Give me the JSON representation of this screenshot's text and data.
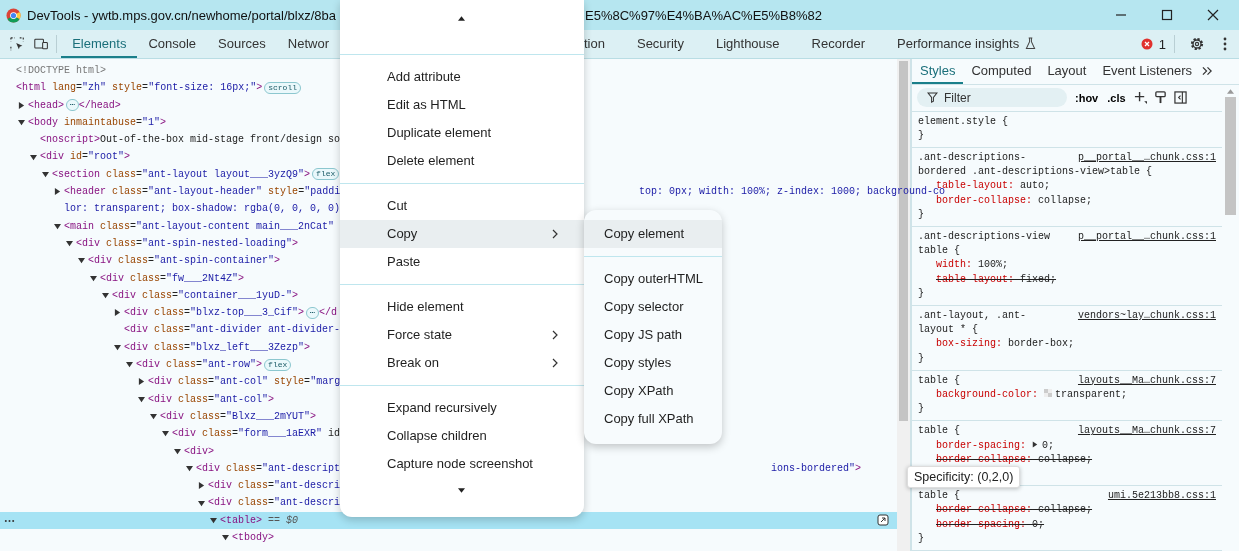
{
  "window": {
    "title": "DevTools - ywtb.mps.gov.cn/newhome/portal/blxz/8ba",
    "title_after_menu": "E5%8C%97%E4%BA%AC%E5%B8%82"
  },
  "tabs": [
    {
      "label": "Elements",
      "selected": true
    },
    {
      "label": "Console",
      "selected": false
    },
    {
      "label": "Sources",
      "selected": false
    },
    {
      "label": "Networ",
      "selected": false
    }
  ],
  "tabs_after_menu": [
    {
      "label": "tion",
      "selected": false
    },
    {
      "label": "Security",
      "selected": false
    },
    {
      "label": "Lighthouse",
      "selected": false
    },
    {
      "label": "Recorder",
      "selected": false
    },
    {
      "label": "Performance insights",
      "selected": false,
      "experimental": true
    }
  ],
  "error_count": "1",
  "dom": [
    {
      "kind": "doctype",
      "text": "<!DOCTYPE html>",
      "selected": false
    },
    {
      "kind": "element",
      "text": "<html lang=\"zh\" style=\"font-size: 16px;\">",
      "badge": "scroll",
      "selected": false,
      "children": [
        {
          "kind": "element",
          "text": "<head>",
          "badge": "⋯",
          "after": "</head>",
          "expanded": false,
          "selected": false
        },
        {
          "kind": "element",
          "text": "<body inmaintabuse=\"1\">",
          "expanded": true,
          "selected": false,
          "children": [
            {
              "kind": "element",
              "text": "<noscript>Out-of-the-box mid-stage front/design so",
              "selected": false
            },
            {
              "kind": "element",
              "text": "<div id=\"root\">",
              "expanded": true,
              "selected": false,
              "children": [
                {
                  "kind": "element",
                  "text": "<section class=\"ant-layout layout___3yzQ9\">",
                  "badge": "flex",
                  "expanded": true,
                  "selected": false,
                  "children": [
                    {
                      "kind": "element",
                      "text": "<header class=\"ant-layout-header\" style=\"paddi",
                      "tail": "top: 0px; width: 100%; z-index: 1000; background-co",
                      "wrap": "lor: transparent; box-shadow: rgba(0, 0, 0, 0)",
                      "expanded": false,
                      "selected": false
                    },
                    {
                      "kind": "element",
                      "text": "<main class=\"ant-layout-content main___2nCat\"",
                      "expanded": true,
                      "selected": false,
                      "children": [
                        {
                          "kind": "element",
                          "text": "<div class=\"ant-spin-nested-loading\">",
                          "expanded": true,
                          "selected": false,
                          "children": [
                            {
                              "kind": "element",
                              "text": "<div class=\"ant-spin-container\">",
                              "expanded": true,
                              "selected": false,
                              "children": [
                                {
                                  "kind": "element",
                                  "text": "<div class=\"fw___2Nt4Z\">",
                                  "expanded": true,
                                  "selected": false,
                                  "children": [
                                    {
                                      "kind": "element",
                                      "text": "<div class=\"container___1yuD-\">",
                                      "expanded": true,
                                      "selected": false,
                                      "children": [
                                        {
                                          "kind": "element",
                                          "text": "<div class=\"blxz-top___3_Cif\">",
                                          "badge": "⋯",
                                          "after": "</d",
                                          "expanded": false,
                                          "selected": false
                                        },
                                        {
                                          "kind": "element",
                                          "text": "<div class=\"ant-divider ant-divider-",
                                          "selected": false
                                        },
                                        {
                                          "kind": "element",
                                          "text": "<div class=\"blxz_left___3Zezp\">",
                                          "expanded": true,
                                          "selected": false,
                                          "children": [
                                            {
                                              "kind": "element",
                                              "text": "<div class=\"ant-row\">",
                                              "badge": "flex",
                                              "expanded": true,
                                              "selected": false,
                                              "children": [
                                                {
                                                  "kind": "element",
                                                  "text": "<div class=\"ant-col\" style=\"marg",
                                                  "expanded": false,
                                                  "selected": false
                                                },
                                                {
                                                  "kind": "element",
                                                  "text": "<div class=\"ant-col\">",
                                                  "expanded": true,
                                                  "selected": false,
                                                  "children": [
                                                    {
                                                      "kind": "element",
                                                      "text": "<div class=\"Blxz___2mYUT\">",
                                                      "expanded": true,
                                                      "selected": false,
                                                      "children": [
                                                        {
                                                          "kind": "element",
                                                          "text": "<div class=\"form___1aEXR\" id",
                                                          "expanded": true,
                                                          "selected": false,
                                                          "children": [
                                                            {
                                                              "kind": "element",
                                                              "text": "<div>",
                                                              "expanded": true,
                                                              "selected": false,
                                                              "children": [
                                                                {
                                                                  "kind": "element",
                                                                  "text": "<div class=\"ant-descript",
                                                                  "tail": "ions-bordered\">",
                                                                  "expanded": true,
                                                                  "selected": false,
                                                                  "children": [
                                                                    {
                                                                      "kind": "element",
                                                                      "text": "<div class=\"ant-descri",
                                                                      "expanded": false,
                                                                      "selected": false
                                                                    },
                                                                    {
                                                                      "kind": "element",
                                                                      "text": "<div class=\"ant-descri",
                                                                      "expanded": true,
                                                                      "selected": false,
                                                                      "children": [
                                                                        {
                                                                          "kind": "element",
                                                                          "text": "<table>",
                                                                          "note": "== $0",
                                                                          "expanded": true,
                                                                          "selected": true,
                                                                          "children": [
                                                                            {
                                                                              "kind": "element",
                                                                              "text": "<tbody>",
                                                                              "expanded": true,
                                                                              "selected": false
                                                                            }
                                                                          ]
                                                                        }
                                                                      ]
                                                                    }
                                                                  ]
                                                                }
                                                              ]
                                                            }
                                                          ]
                                                        }
                                                      ]
                                                    }
                                                  ]
                                                }
                                              ]
                                            }
                                          ]
                                        }
                                      ]
                                    }
                                  ]
                                }
                              ]
                            }
                          ]
                        }
                      ]
                    }
                  ]
                }
              ]
            }
          ]
        }
      ]
    }
  ],
  "context_menu": {
    "groups": [
      [
        {
          "label": "Add attribute",
          "submenu": false,
          "selected": false
        },
        {
          "label": "Edit as HTML",
          "submenu": false,
          "selected": false
        },
        {
          "label": "Duplicate element",
          "submenu": false,
          "selected": false
        },
        {
          "label": "Delete element",
          "submenu": false,
          "selected": false
        }
      ],
      [
        {
          "label": "Cut",
          "submenu": false,
          "selected": false
        },
        {
          "label": "Copy",
          "submenu": true,
          "selected": true
        },
        {
          "label": "Paste",
          "submenu": false,
          "selected": false
        }
      ],
      [
        {
          "label": "Hide element",
          "submenu": false,
          "selected": false
        },
        {
          "label": "Force state",
          "submenu": true,
          "selected": false
        },
        {
          "label": "Break on",
          "submenu": true,
          "selected": false
        }
      ],
      [
        {
          "label": "Expand recursively",
          "submenu": false,
          "selected": false
        },
        {
          "label": "Collapse children",
          "submenu": false,
          "selected": false
        },
        {
          "label": "Capture node screenshot",
          "submenu": false,
          "selected": false
        }
      ]
    ]
  },
  "copy_submenu": {
    "groups": [
      [
        {
          "label": "Copy element",
          "selected": true
        }
      ],
      [
        {
          "label": "Copy outerHTML",
          "selected": false
        },
        {
          "label": "Copy selector",
          "selected": false
        },
        {
          "label": "Copy JS path",
          "selected": false
        },
        {
          "label": "Copy styles",
          "selected": false
        },
        {
          "label": "Copy XPath",
          "selected": false
        },
        {
          "label": "Copy full XPath",
          "selected": false
        }
      ]
    ]
  },
  "styles": {
    "tabs": [
      {
        "label": "Styles",
        "selected": true
      },
      {
        "label": "Computed",
        "selected": false
      },
      {
        "label": "Layout",
        "selected": false
      },
      {
        "label": "Event Listeners",
        "selected": false
      }
    ],
    "filter": {
      "placeholder": "Filter"
    },
    "hov": ":hov",
    "cls": ".cls",
    "rules": [
      {
        "selector": [
          "element.style {"
        ],
        "close": "}"
      },
      {
        "selector": [
          ".ant-descriptions-",
          "bordered .ant-descriptions-view>table {"
        ],
        "source": "p__portal__…chunk.css:1",
        "close": "}",
        "props": [
          {
            "name": "table-layout:",
            "value": "auto;",
            "struck": false
          },
          {
            "name": "border-collapse:",
            "value": "collapse;",
            "struck": false
          }
        ]
      },
      {
        "selector": [
          ".ant-descriptions-view",
          "table {"
        ],
        "source": "p__portal__…chunk.css:1",
        "close": "}",
        "props": [
          {
            "name": "width:",
            "value": "100%;",
            "struck": false
          },
          {
            "name": "table-layout:",
            "value": "fixed;",
            "struck": true
          }
        ]
      },
      {
        "selector": [
          ".ant-layout, .ant-",
          "layout * {"
        ],
        "source": "vendors~lay…chunk.css:1",
        "close": "}",
        "props": [
          {
            "name": "box-sizing:",
            "value": "border-box;",
            "struck": false
          }
        ]
      },
      {
        "selector": [
          "table {"
        ],
        "source": "layouts__Ma…chunk.css:7",
        "close": "}",
        "props": [
          {
            "name": "background-color:",
            "value": "transparent;",
            "struck": false,
            "swatch": true
          }
        ]
      },
      {
        "selector": [
          "table {"
        ],
        "source": "layouts__Ma…chunk.css:7",
        "tooltip": "Specificity: (0,2,0)",
        "props": [
          {
            "name": "border-spacing:",
            "value": "0;",
            "struck": false,
            "expandable": true
          },
          {
            "name": "border-collapse:",
            "value": "collapse;",
            "struck": true
          }
        ]
      },
      {
        "selector": [
          "table {"
        ],
        "source": "umi.5e213bb8.css:1",
        "close": "}",
        "props": [
          {
            "name": "border-collapse:",
            "value": "collapse;",
            "struck": true
          },
          {
            "name": "border-spacing:",
            "value": "0;",
            "struck": true
          }
        ]
      }
    ]
  }
}
